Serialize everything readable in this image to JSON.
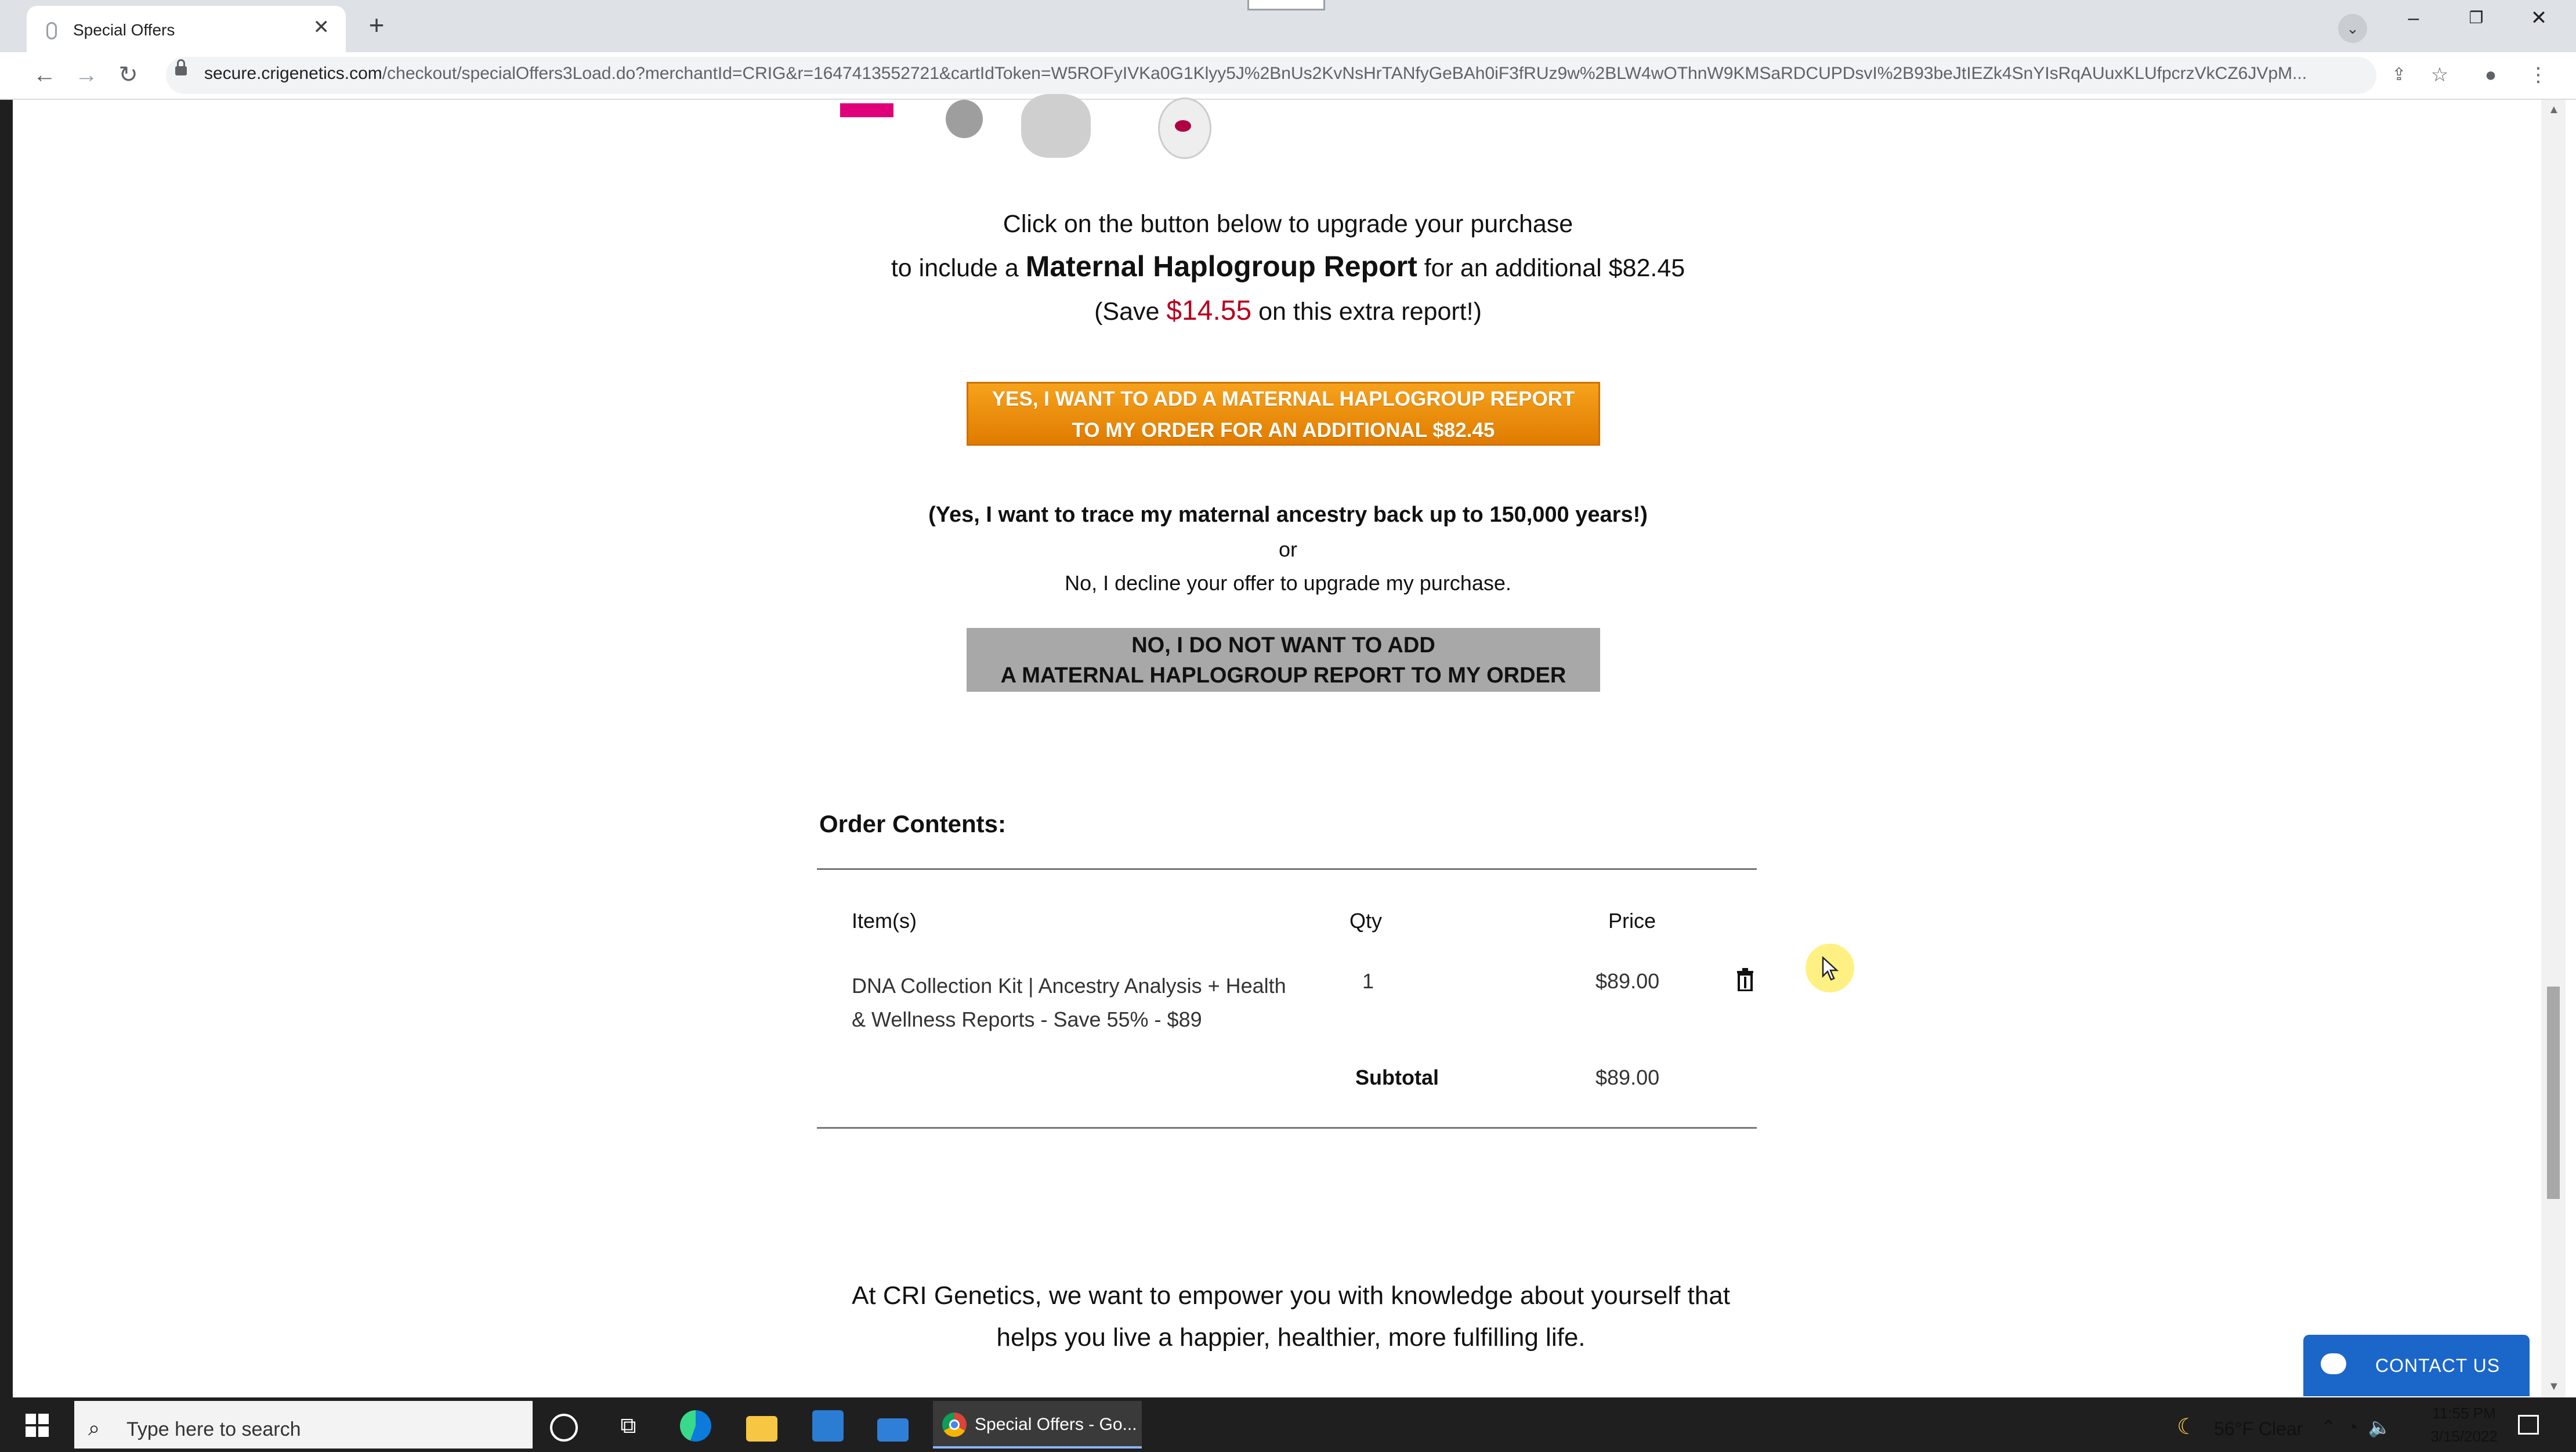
{
  "browser": {
    "tab_title": "Special Offers",
    "tab_close": "✕",
    "new_tab": "+",
    "url_host": "secure.crigenetics.com",
    "url_path": "/checkout/specialOffers3Load.do?merchantId=CRIG&r=1647413552721&cartIdToken=W5ROFyIVKa0G1Klyy5J%2BnUs2KvNsHrTANfyGeBAh0iF3fRUz9w%2BLW4wOThnW9KMSaRDCUPDsvI%2B93beJtIEZk4SnYIsRqAUuxKLUfpcrzVkCZ6JVpM..."
  },
  "offer": {
    "line1": "Click on the button below to upgrade your purchase",
    "line2_prefix": "to include a ",
    "line2_bold": "Maternal Haplogroup Report",
    "line2_suffix": " for an additional $82.45",
    "line3_prefix": "(Save ",
    "line3_amount": "$14.55",
    "line3_suffix": " on this extra report!)",
    "yes_button_line1": "YES, I WANT TO ADD A MATERNAL HAPLOGROUP REPORT",
    "yes_button_line2": "TO MY ORDER FOR AN ADDITIONAL $82.45",
    "trace_text": "(Yes, I want to trace my maternal ancestry back up to 150,000 years!)",
    "or_text": "or",
    "decline_text": "No, I decline your offer to upgrade my purchase.",
    "no_button_line1": "NO, I DO NOT WANT TO ADD",
    "no_button_line2": "A MATERNAL HAPLOGROUP REPORT TO MY ORDER"
  },
  "order": {
    "heading": "Order Contents:",
    "columns": {
      "items": "Item(s)",
      "qty": "Qty",
      "price": "Price"
    },
    "rows": [
      {
        "item_line1": "DNA Collection Kit | Ancestry Analysis + Health",
        "item_line2": "& Wellness Reports - Save 55% - $89",
        "qty": "1",
        "price": "$89.00"
      }
    ],
    "subtotal_label": "Subtotal",
    "subtotal_value": "$89.00"
  },
  "footer_text": {
    "line1": "At CRI Genetics, we want to empower you with knowledge about yourself that",
    "line2": "helps you live a happier, healthier, more fulfilling life."
  },
  "contact_button": "CONTACT US",
  "taskbar": {
    "search_placeholder": "Type here to search",
    "active_window": "Special Offers - Go...",
    "weather": "56°F  Clear",
    "time": "11:55 PM",
    "date": "3/15/2022"
  },
  "colors": {
    "yes_button": "#f39a12",
    "no_button": "#a8a8a8",
    "save_amount": "#b8001f",
    "contact_button": "#1b66c9"
  },
  "icons": [
    "back-icon",
    "forward-icon",
    "reload-icon",
    "lock-icon",
    "share-icon",
    "star-icon",
    "profile-icon",
    "menu-icon",
    "trash-icon",
    "chat-icon",
    "windows-icon",
    "search-icon",
    "cortana-icon",
    "task-view-icon",
    "edge-icon",
    "file-explorer-icon",
    "store-icon",
    "mail-icon",
    "chrome-icon",
    "moon-icon",
    "notification-icon"
  ]
}
